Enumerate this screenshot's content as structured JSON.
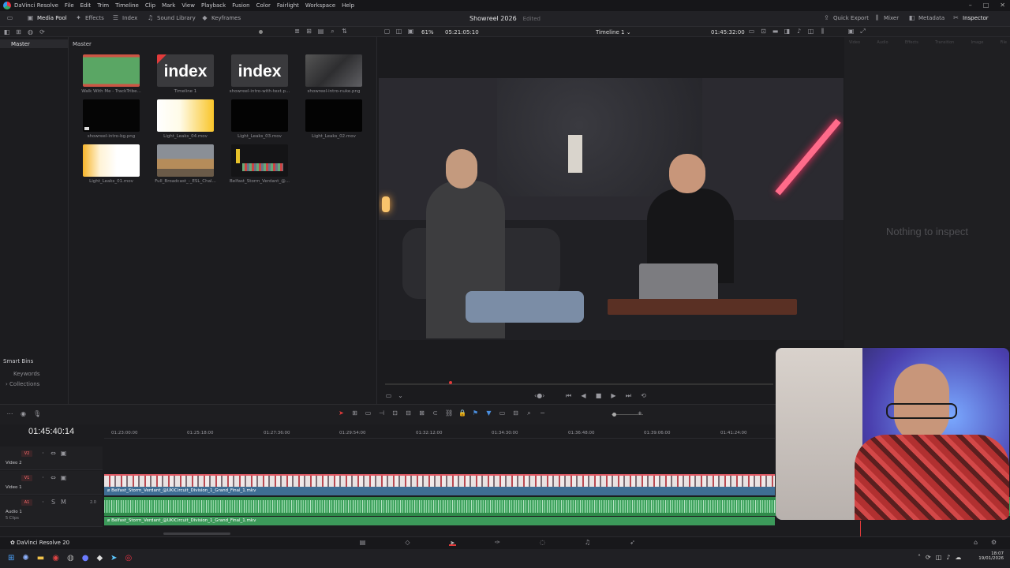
{
  "menubar": {
    "app": "DaVinci Resolve",
    "items": [
      "File",
      "Edit",
      "Trim",
      "Timeline",
      "Clip",
      "Mark",
      "View",
      "Playback",
      "Fusion",
      "Color",
      "Fairlight",
      "Workspace",
      "Help"
    ]
  },
  "toolbar": {
    "media_pool": "Media Pool",
    "effects": "Effects",
    "index": "Index",
    "sound_library": "Sound Library",
    "keyframes": "Keyframes",
    "quick_export": "Quick Export",
    "mixer": "Mixer",
    "metadata": "Metadata",
    "inspector": "Inspector"
  },
  "project": {
    "title": "Showreel 2026",
    "status": "Edited"
  },
  "viewer_bar": {
    "zoom": "61%",
    "source_tc": "05:21:05:10",
    "timeline_name": "Timeline 1",
    "record_tc": "01:45:32:00"
  },
  "left_panel": {
    "master": "Master",
    "smart_bins": "Smart Bins",
    "keywords": "Keywords",
    "collections": "Collections"
  },
  "media_pool": {
    "breadcrumb": "Master",
    "clips": [
      {
        "name": "Walk With Me - TrackTribe...",
        "kind": "green"
      },
      {
        "name": "Timeline 1",
        "kind": "index",
        "label": "index"
      },
      {
        "name": "showreel-intro-with-text.p...",
        "kind": "index",
        "label": "index"
      },
      {
        "name": "showreel-intro-nuke.png",
        "kind": "gray"
      },
      {
        "name": "showreel-intro-bg.png",
        "kind": "black"
      },
      {
        "name": "Light_Leaks_04.mov",
        "kind": "leak"
      },
      {
        "name": "Light_Leaks_03.mov",
        "kind": "black"
      },
      {
        "name": "Light_Leaks_02.mov",
        "kind": "black"
      },
      {
        "name": "Light_Leaks_01.mov",
        "kind": "leak2"
      },
      {
        "name": "Full_Broadcast_-_ESL_Chal...",
        "kind": "game"
      },
      {
        "name": "Belfast_Storm_Verdant_@...",
        "kind": "dark"
      }
    ]
  },
  "inspector": {
    "tabs": [
      "Video",
      "Audio",
      "Effects",
      "Transition",
      "Image",
      "File"
    ],
    "empty": "Nothing to inspect"
  },
  "timeline": {
    "timecode": "01:45:40:14",
    "ruler": [
      "01:23:00:00",
      "01:25:18:00",
      "01:27:36:00",
      "01:29:54:00",
      "01:32:12:00",
      "01:34:30:00",
      "01:36:48:00",
      "01:39:06:00",
      "01:41:24:00"
    ],
    "tracks": [
      {
        "badge": "V2",
        "name": "Video 2"
      },
      {
        "badge": "V1",
        "name": "Video 1"
      },
      {
        "badge": "A1",
        "name": "Audio 1",
        "sub": "5 Clips",
        "level": "2.0"
      }
    ],
    "video_clip": "Belfast_Storm_Verdant_@UKICircuit_Division_1_Grand_Final_1.mkv",
    "audio_clip": "Belfast_Storm_Verdant_@UKICircuit_Division_1_Grand_Final_1.mkv"
  },
  "pagebar": {
    "app": "DaVinci Resolve 20"
  },
  "taskbar": {
    "time": "18:07",
    "date": "19/01/2026"
  },
  "colors": {
    "accent": "#e64646",
    "clip_blue": "#3f6e94",
    "audio_green": "#3c9a5a",
    "playhead": "#e23b3b"
  }
}
